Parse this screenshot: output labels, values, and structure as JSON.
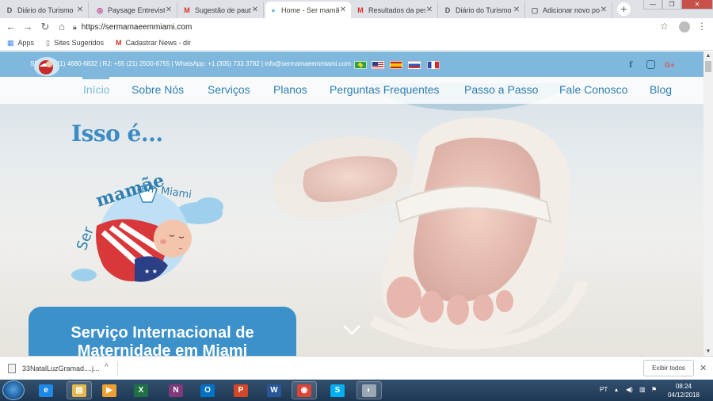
{
  "browser": {
    "tabs": [
      {
        "title": "Diário do Turismo",
        "favicon": "D",
        "favicon_color": "#555555",
        "active": false
      },
      {
        "title": "Paysage Entrevista",
        "favicon": "◎",
        "favicon_color": "#c13584",
        "active": false
      },
      {
        "title": "Sugestão de pauta",
        "favicon": "M",
        "favicon_color": "#d93025",
        "active": false
      },
      {
        "title": "Home - Ser mamãe",
        "favicon": "●",
        "favicon_color": "#7fb8dc",
        "active": true
      },
      {
        "title": "Resultados da pesq",
        "favicon": "M",
        "favicon_color": "#d93025",
        "active": false
      },
      {
        "title": "Diário do Turismo",
        "favicon": "D",
        "favicon_color": "#555555",
        "active": false
      },
      {
        "title": "Adicionar novo pos",
        "favicon": "▢",
        "favicon_color": "#5f6368",
        "active": false
      }
    ],
    "new_tab": "+",
    "close_glyph": "✕",
    "window_controls": {
      "minimize": "—",
      "maximize": "❐",
      "close": "✕"
    },
    "url": "https://sermamaeemmiami.com",
    "bookmarks": [
      {
        "label": "Apps",
        "icon": "grid-icon"
      },
      {
        "label": "Sites Sugeridos",
        "icon": "page-icon"
      },
      {
        "label": "Cadastrar News - dir",
        "icon": "gmail-icon"
      }
    ]
  },
  "site": {
    "contact_line": "SP: +55 (11) 4680-6832 | RJ: +55 (21) 2500-6755 | WhatsApp: +1 (305) 733 3782 | info@sermamaeemmiami.com",
    "nav": [
      "Início",
      "Sobre Nós",
      "Serviços",
      "Planos",
      "Perguntas Frequentes",
      "Passo a Passo",
      "Fale Conosco",
      "Blog"
    ],
    "active_nav": "Início",
    "hero_heading": "Isso é...",
    "logo_text": {
      "ser": "Ser",
      "mamae": "mamãe",
      "em_miami": "em Miami"
    },
    "banner_line1": "Serviço Internacional de",
    "banner_line2": "Maternidade em Miami",
    "colors": {
      "brand_light": "#7fb8dc",
      "brand_dark": "#2e7fb0",
      "banner": "#3c91cb"
    }
  },
  "downloads": {
    "file": "33NatalLuzGramad....j...",
    "show_all": "Exibir todos"
  },
  "taskbar": {
    "apps": [
      {
        "name": "ie",
        "label": "e",
        "color": "#1e88e5"
      },
      {
        "name": "explorer",
        "label": "▤",
        "color": "#e3b94d"
      },
      {
        "name": "media",
        "label": "▶",
        "color": "#f0a030"
      },
      {
        "name": "excel",
        "label": "X",
        "color": "#1e7145"
      },
      {
        "name": "onenote",
        "label": "N",
        "color": "#80397b"
      },
      {
        "name": "outlook",
        "label": "O",
        "color": "#0072c6"
      },
      {
        "name": "powerpoint",
        "label": "P",
        "color": "#d24726"
      },
      {
        "name": "word",
        "label": "W",
        "color": "#2b579a"
      },
      {
        "name": "chrome",
        "label": "◉",
        "color": "#db4437"
      },
      {
        "name": "skype",
        "label": "S",
        "color": "#00aff0"
      },
      {
        "name": "disk",
        "label": "◐",
        "color": "#9aa7b4"
      }
    ],
    "language": "PT",
    "time": "08:24",
    "date": "04/12/2018"
  }
}
